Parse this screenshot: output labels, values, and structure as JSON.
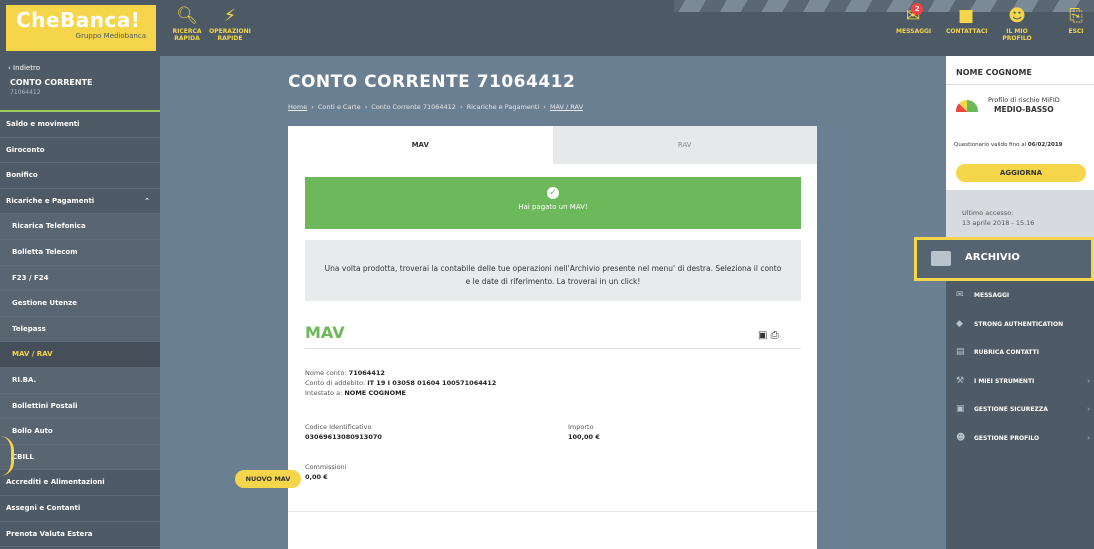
{
  "brand": {
    "name": "CheBanca!",
    "sub": "Gruppo Mediobanca"
  },
  "topnav": {
    "search": {
      "label1": "RICERCA",
      "label2": "RAPIDA",
      "icon": "search-icon"
    },
    "quick": {
      "label1": "OPERAZIONI",
      "label2": "RAPIDE",
      "icon": "lightning-icon"
    },
    "messages": {
      "label": "MESSAGGI",
      "badge": "2"
    },
    "contacts": {
      "label": "CONTATTACI"
    },
    "profile": {
      "label1": "IL MIO",
      "label2": "PROFILO"
    },
    "logout": {
      "label": "ESCI"
    }
  },
  "sidebar": {
    "back": "‹ Indietro",
    "current_title": "CONTO CORRENTE",
    "current_sub": "71064412",
    "items": [
      {
        "label": "Saldo e movimenti",
        "sub": false
      },
      {
        "label": "Giroconto",
        "sub": false
      },
      {
        "label": "Bonifico",
        "sub": false
      },
      {
        "label": "Ricariche e Pagamenti",
        "sub": false,
        "caret": "⌃"
      },
      {
        "label": "Ricarica Telefonica",
        "sub": true
      },
      {
        "label": "Bolletta Telecom",
        "sub": true
      },
      {
        "label": "F23 / F24",
        "sub": true
      },
      {
        "label": "Gestione Utenze",
        "sub": true
      },
      {
        "label": "Telepass",
        "sub": true
      },
      {
        "label": "MAV / RAV",
        "sub": true,
        "active": true
      },
      {
        "label": "RI.BA.",
        "sub": true
      },
      {
        "label": "Bollettini Postali",
        "sub": true
      },
      {
        "label": "Bollo Auto",
        "sub": true
      },
      {
        "label": "CBILL",
        "sub": true
      },
      {
        "label": "Accrediti e Alimentazioni",
        "sub": false
      },
      {
        "label": "Assegni e Contanti",
        "sub": false
      },
      {
        "label": "Prenota Valuta Estera",
        "sub": false
      }
    ]
  },
  "main": {
    "title": "CONTO CORRENTE 71064412",
    "breadcrumb": [
      "Home",
      "›",
      "Conti e Carte",
      "›",
      "Conto Corrente 71064412",
      "›",
      "Ricariche e Pagamenti",
      "›",
      "MAV / RAV"
    ],
    "tabs": {
      "active": "MAV",
      "inactive": "RAV"
    },
    "success_msg": "Hai pagato un MAV!",
    "info_msg": "Una volta prodotta, troverai la contabile delle tue operazioni nell'Archivio presente nel menu' di destra. Seleziona il conto e le date di riferimento. La troverai in un click!",
    "section_title": "MAV",
    "detail": {
      "conto_label": "Nome conto:",
      "conto_value": "71064412",
      "addebito_label": "Conto di addebito:",
      "addebito_value": "IT 19 I 03058 01604 100571064412",
      "intestato_label": "Intestato a:",
      "intestato_value": "NOME COGNOME",
      "codice_label": "Codice Identificativo",
      "codice_value": "03069613080913070",
      "importo_label": "Importo",
      "importo_value": "100,00 €",
      "commissioni_label": "Commissioni",
      "commissioni_value": "0,00 €"
    },
    "new_button": "NUOVO MAV"
  },
  "rpanel": {
    "name": "NOME COGNOME",
    "risk_label": "Profilo di rischio MiFID",
    "risk_value": "MEDIO-BASSO",
    "questionnaire_prefix": "Questionario valido fino al",
    "questionnaire_date": "06/02/2019",
    "update_button": "AGGIORNA",
    "last_access_label": "Ultimo accesso:",
    "last_access_value": "13 aprile 2018 - 15.16",
    "archive": "ARCHIVIO",
    "menu": [
      {
        "label": "MESSAGGI",
        "icon": "envelope-icon",
        "arrow": false
      },
      {
        "label": "STRONG AUTHENTICATION",
        "icon": "shield-icon",
        "arrow": false
      },
      {
        "label": "RUBRICA CONTATTI",
        "icon": "address-book-icon",
        "arrow": false
      },
      {
        "label": "I MIEI STRUMENTI",
        "icon": "wrench-icon",
        "arrow": true
      },
      {
        "label": "GESTIONE SICUREZZA",
        "icon": "lock-icon",
        "arrow": true
      },
      {
        "label": "GESTIONE PROFILO",
        "icon": "user-icon",
        "arrow": true
      }
    ]
  }
}
